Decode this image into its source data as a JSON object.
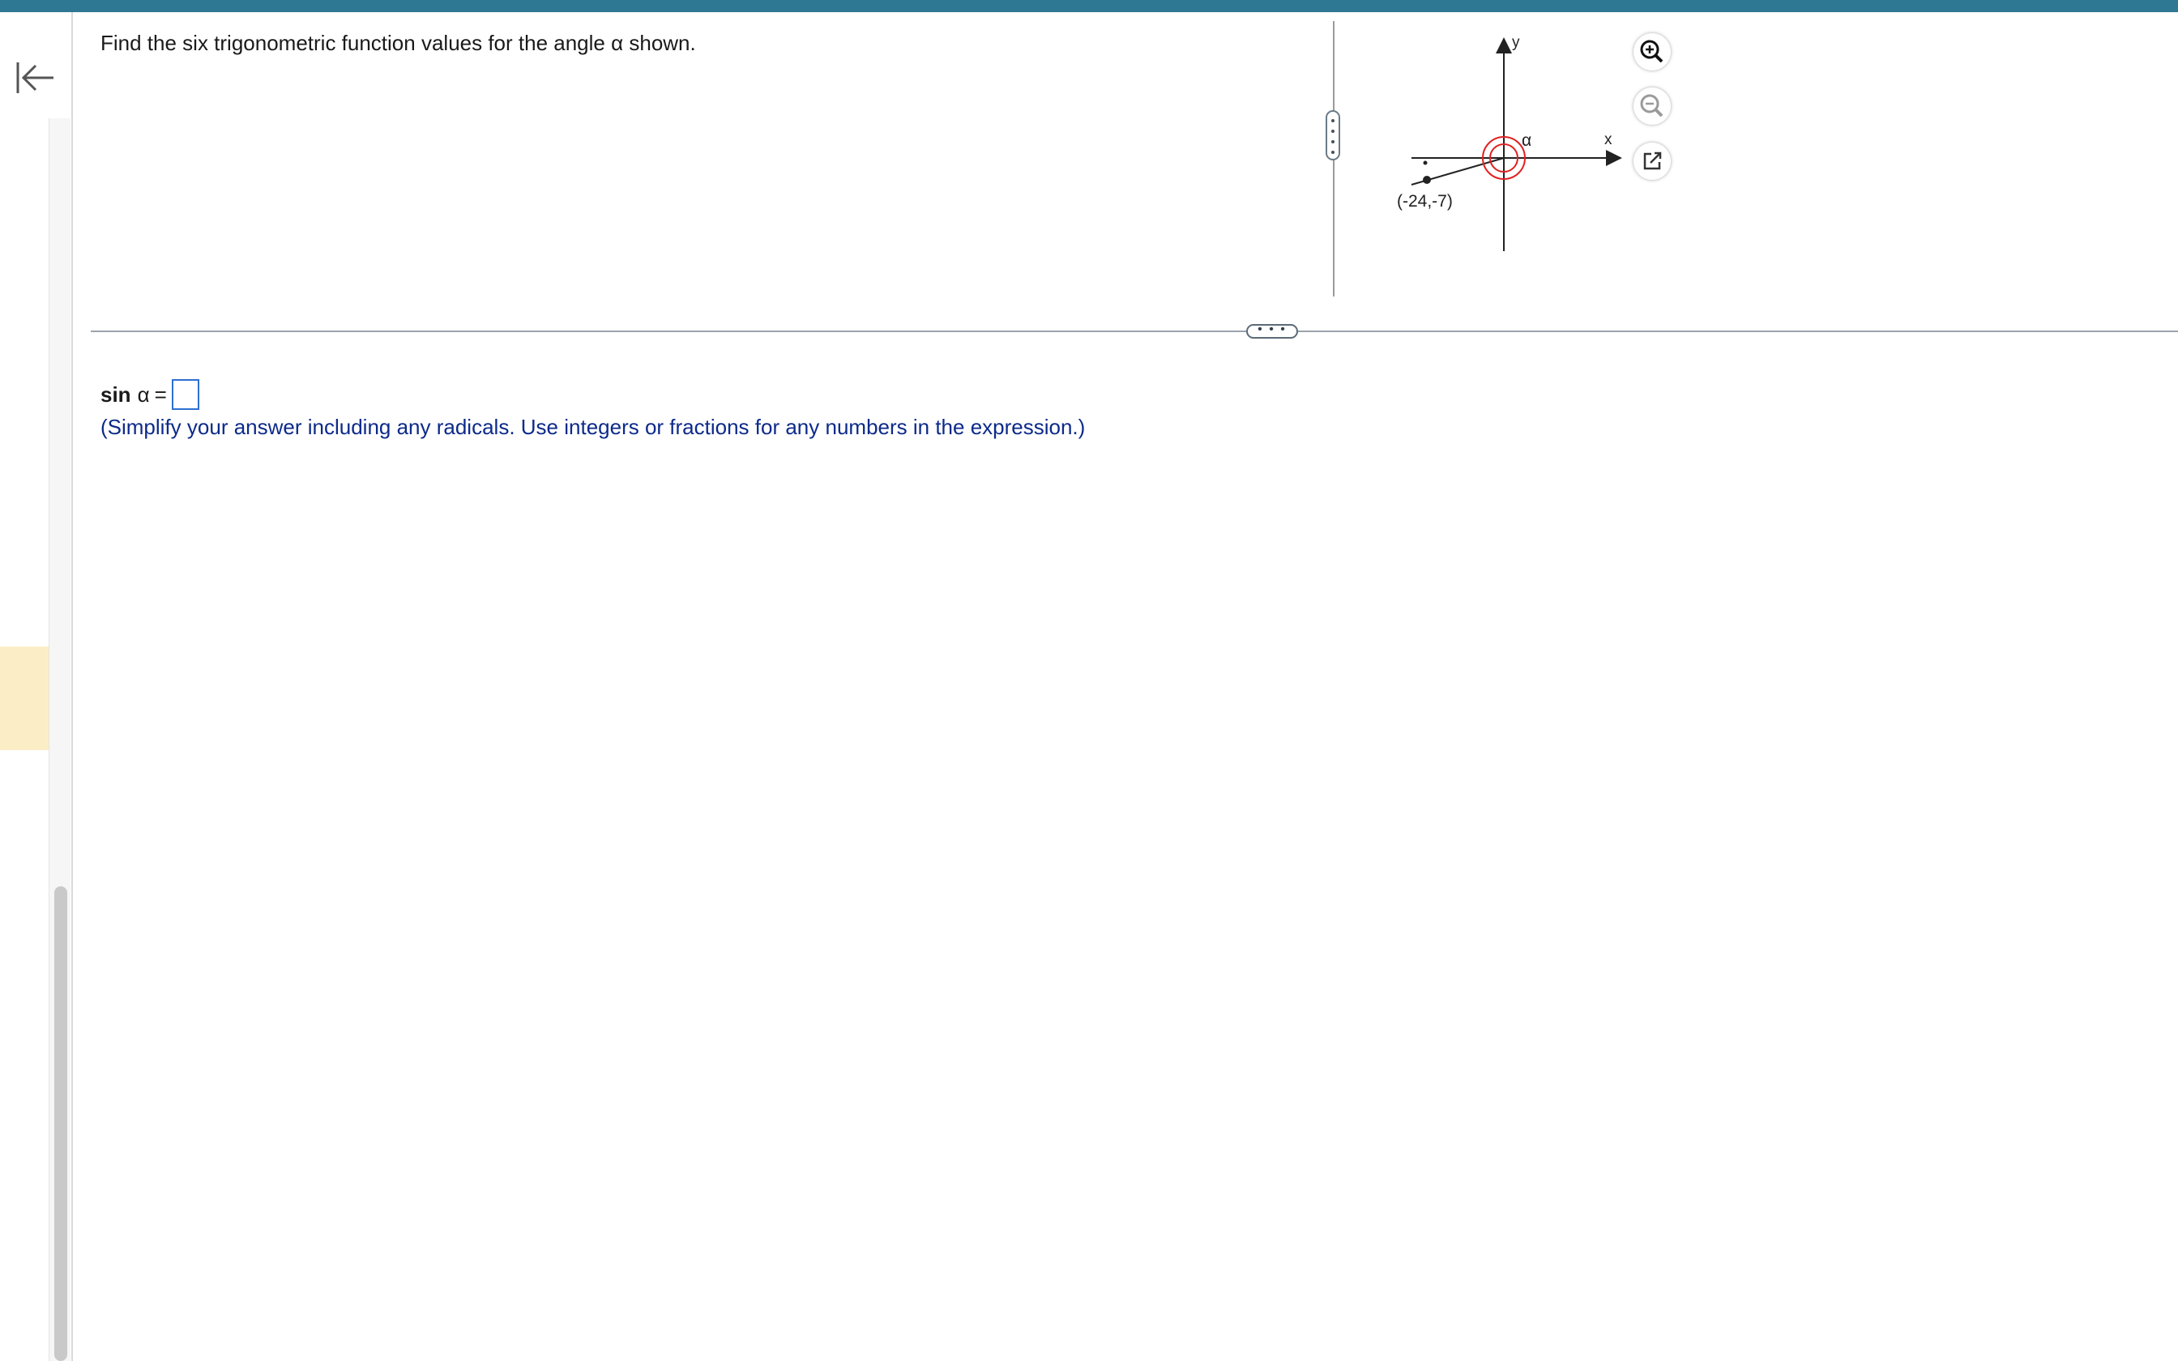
{
  "question": {
    "text": "Find the six trigonometric function values for the angle α shown."
  },
  "graph": {
    "y_label": "y",
    "x_label": "x",
    "angle_label": "α",
    "point_label": "(-24,-7)"
  },
  "answer": {
    "function_label": "sin",
    "angle_symbol": "α",
    "equals": "="
  },
  "hint": {
    "text": "(Simplify your answer including any radicals. Use integers or fractions for any numbers in the expression.)"
  },
  "splitter": {
    "horizontal_handle": "• • •"
  },
  "colors": {
    "top_bar": "#2f7893",
    "hint_text": "#0c2a8a",
    "answer_box_border": "#2e6fd1",
    "angle_arc": "#e02020",
    "left_rail_highlight": "#fbeec7"
  },
  "icons": {
    "back": "collapse-left-icon",
    "zoom_in": "zoom-in-icon",
    "zoom_out": "zoom-out-icon",
    "popout": "popout-icon"
  }
}
